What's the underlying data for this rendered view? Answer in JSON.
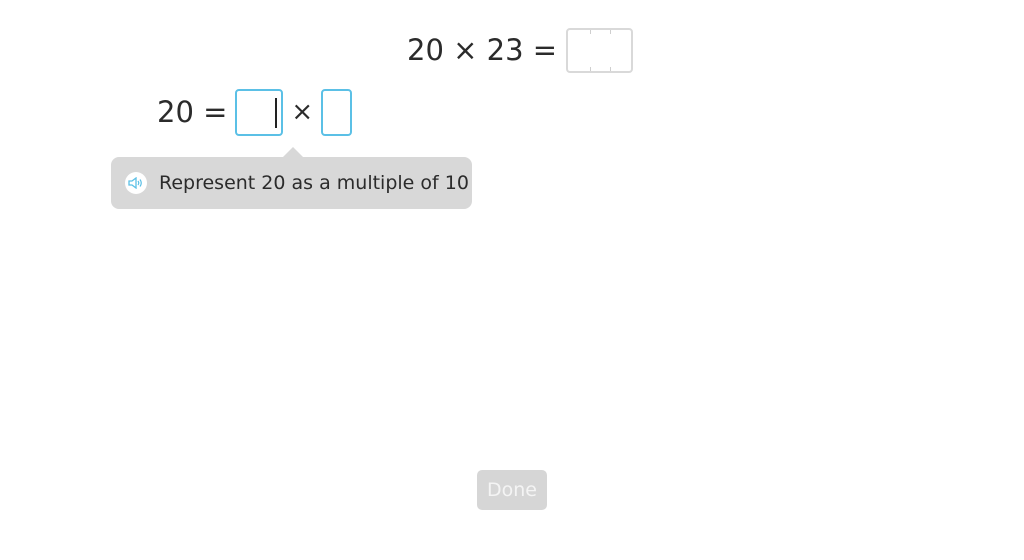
{
  "problem": {
    "equation_left": "20 × 23 =",
    "answer_value": ""
  },
  "decomposition": {
    "left": "20 =",
    "factor1_value": "",
    "operator": "×",
    "factor2_value": ""
  },
  "hint": {
    "icon": "speaker-icon",
    "text": "Represent 20 as a multiple of 10"
  },
  "actions": {
    "done_label": "Done",
    "done_enabled": false
  },
  "colors": {
    "accent": "#5bc0e6",
    "tooltip_bg": "#d8d8d8",
    "disabled_button": "#d6d6d6"
  }
}
